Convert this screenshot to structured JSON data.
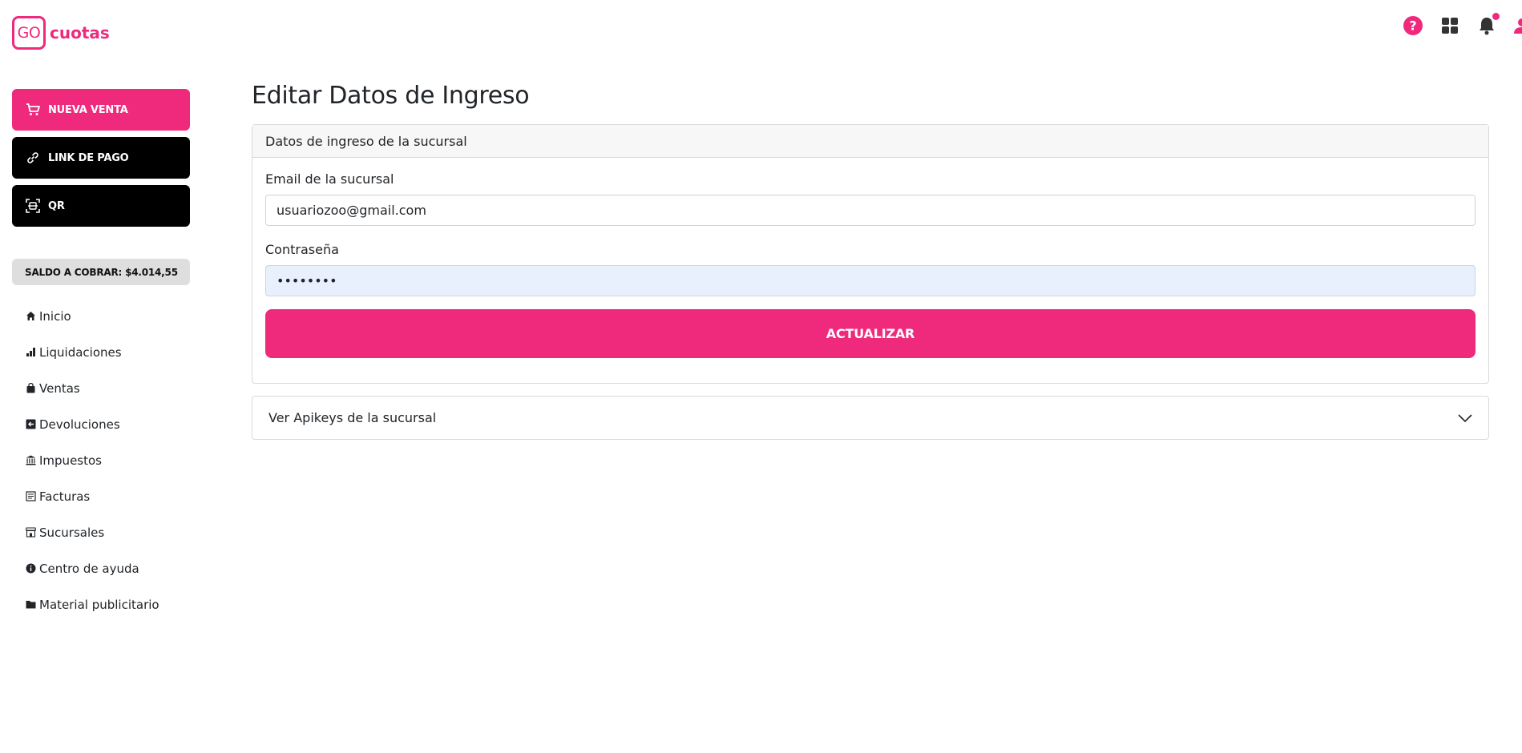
{
  "brand": {
    "logo_box": "GO",
    "logo_text": "cuotas",
    "accent": "#ef2a7d"
  },
  "header": {
    "icons": [
      "help-icon",
      "grid-icon",
      "bell-icon",
      "user-icon"
    ],
    "notification_dot": true
  },
  "sidebar": {
    "actions": [
      {
        "label": "NUEVA VENTA",
        "icon": "cart-icon",
        "style": "pink"
      },
      {
        "label": "LINK DE PAGO",
        "icon": "link-icon",
        "style": "black"
      },
      {
        "label": "QR",
        "icon": "qr-scan-icon",
        "style": "black"
      }
    ],
    "saldo": "SALDO A COBRAR: $4.014,55",
    "items": [
      {
        "label": "Inicio",
        "icon": "home-icon"
      },
      {
        "label": "Liquidaciones",
        "icon": "bar-chart-icon"
      },
      {
        "label": "Ventas",
        "icon": "bag-icon"
      },
      {
        "label": "Devoluciones",
        "icon": "return-icon"
      },
      {
        "label": "Impuestos",
        "icon": "bank-icon"
      },
      {
        "label": "Facturas",
        "icon": "invoice-icon"
      },
      {
        "label": "Sucursales",
        "icon": "store-icon"
      },
      {
        "label": "Centro de ayuda",
        "icon": "info-icon"
      },
      {
        "label": "Material publicitario",
        "icon": "folder-icon"
      }
    ]
  },
  "main": {
    "title": "Editar Datos de Ingreso",
    "card": {
      "header": "Datos de ingreso de la sucursal",
      "email_label": "Email de la sucursal",
      "email_value": "usuariozoo@gmail.com",
      "password_label": "Contraseña",
      "password_value": "••••••••",
      "submit_label": "ACTUALIZAR"
    },
    "accordion": {
      "label": "Ver Apikeys de la sucursal",
      "icon": "chevron-down-icon"
    }
  }
}
